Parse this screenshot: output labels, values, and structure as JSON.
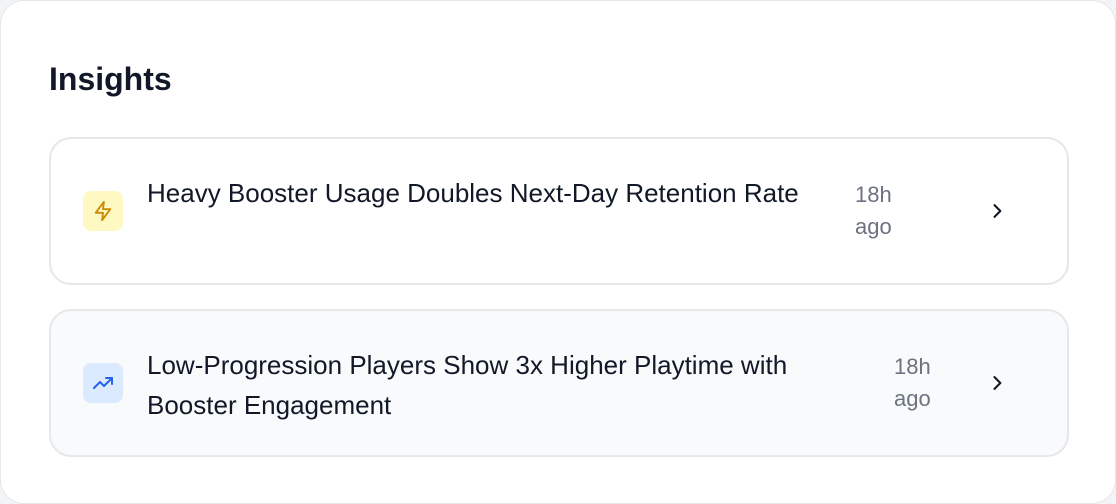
{
  "panel": {
    "title": "Insights"
  },
  "insights": [
    {
      "title": "Heavy Booster Usage Doubles Next-Day Retention Rate",
      "time": "18h ago",
      "icon": "lightning-bolt-icon",
      "icon_color": "#ca8a04",
      "icon_bg": "#fef9c3"
    },
    {
      "title": "Low-Progression Players Show 3x Higher Playtime with Booster Engagement",
      "time": "18h ago",
      "icon": "trending-up-icon",
      "icon_color": "#2563eb",
      "icon_bg": "#dbeafe"
    }
  ]
}
